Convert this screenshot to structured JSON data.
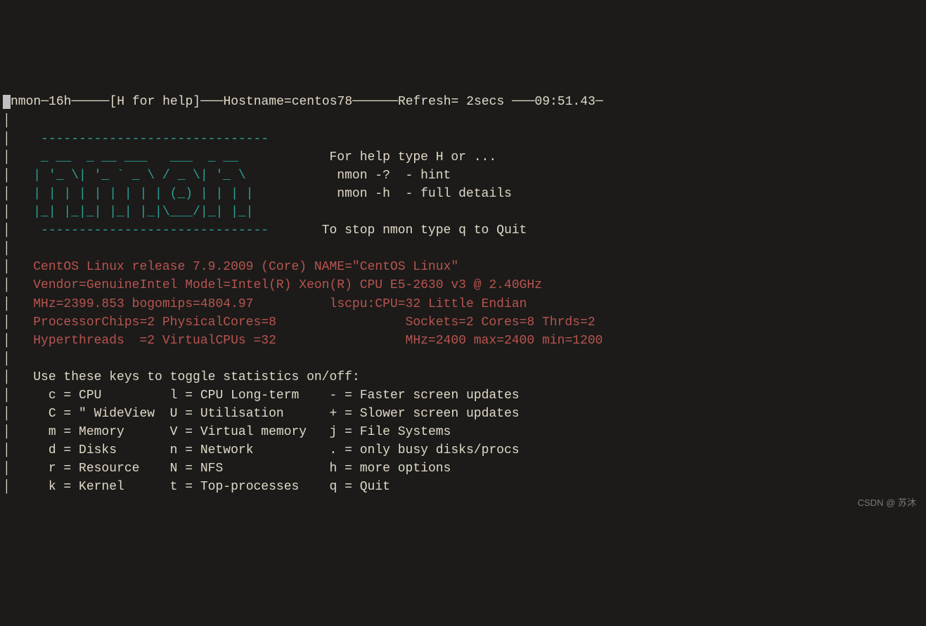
{
  "header": {
    "app": "nmon",
    "version_suffix": "16h",
    "help_hint": "[H for help]",
    "hostname_label": "Hostname=",
    "hostname": "centos78",
    "refresh_label": "Refresh= ",
    "refresh_value": "2secs",
    "time": "09:51.43"
  },
  "logo": {
    "dash_top": "    ------------------------------",
    "l1": "    _ __  _ __ ___   ___  _ __     ",
    "l2": "   | '_ \\| '_ ` _ \\ / _ \\| '_ \\    ",
    "l3": "   | | | | | | | | | (_) | | | |   ",
    "l4": "   |_| |_|_| |_| |_|\\___/|_| |_|   ",
    "dash_bottom": "    ------------------------------"
  },
  "help_box": {
    "line1": "For help type H or ...",
    "line2": " nmon -?  - hint",
    "line3": " nmon -h  - full details",
    "line4": "To stop nmon type q to Quit"
  },
  "sysinfo": {
    "l1": "CentOS Linux release 7.9.2009 (Core) NAME=\"CentOS Linux\"",
    "l2": "Vendor=GenuineIntel Model=Intel(R) Xeon(R) CPU E5-2630 v3 @ 2.40GHz",
    "l3a": "MHz=2399.853 bogomips=4804.97",
    "l3b": "lscpu:CPU=32 Little Endian",
    "l4a": "ProcessorChips=2 PhysicalCores=8",
    "l4b": "Sockets=2 Cores=8 Thrds=2",
    "l5a": "Hyperthreads  =2 VirtualCPUs =32",
    "l5b": "MHz=2400 max=2400 min=1200"
  },
  "toggle": {
    "heading": "Use these keys to toggle statistics on/off:",
    "rows": [
      {
        "c1": "  c = CPU        ",
        "c2": "l = CPU Long-term   ",
        "c3": "- = Faster screen updates"
      },
      {
        "c1": "  C = \" WideView ",
        "c2": "U = Utilisation     ",
        "c3": "+ = Slower screen updates"
      },
      {
        "c1": "  m = Memory     ",
        "c2": "V = Virtual memory  ",
        "c3": "j = File Systems"
      },
      {
        "c1": "  d = Disks      ",
        "c2": "n = Network         ",
        "c3": ". = only busy disks/procs"
      },
      {
        "c1": "  r = Resource   ",
        "c2": "N = NFS             ",
        "c3": "h = more options"
      },
      {
        "c1": "  k = Kernel     ",
        "c2": "t = Top-processes   ",
        "c3": "q = Quit"
      }
    ]
  },
  "watermark": "CSDN @ 苏沐"
}
